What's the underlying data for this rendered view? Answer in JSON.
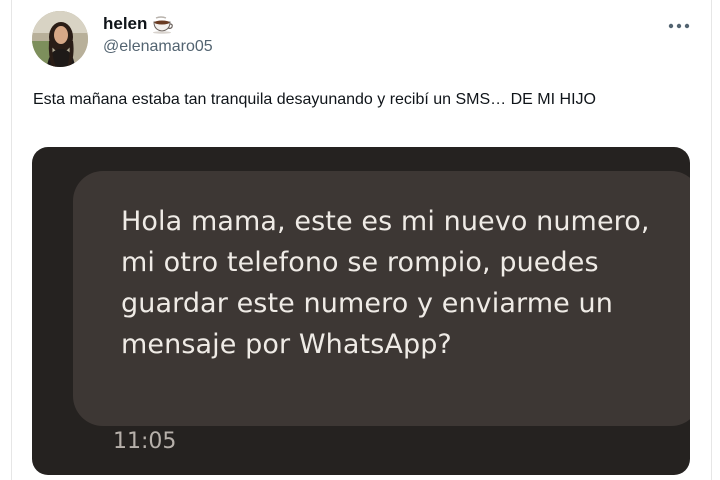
{
  "tweet": {
    "author": {
      "name": "helen",
      "name_emoji_icon": "coffee-cup-icon",
      "handle": "@elenamaro05",
      "avatar": "profile-photo-avatar"
    },
    "more_icon": "ellipsis-icon",
    "text": "Esta mañana estaba tan tranquila desayunando y recibí un SMS… DE MI HIJO",
    "media": {
      "sms_message": "Hola mama, este es mi nuevo numero, mi otro telefono se rompio, puedes guardar este numero y enviarme un mensaje por WhatsApp?",
      "sms_time": "11:05"
    }
  },
  "colors": {
    "text_primary": "#0f1419",
    "text_secondary": "#536471",
    "media_background": "#252220",
    "sms_bubble": "#3d3734",
    "sms_text": "#efebe6"
  }
}
